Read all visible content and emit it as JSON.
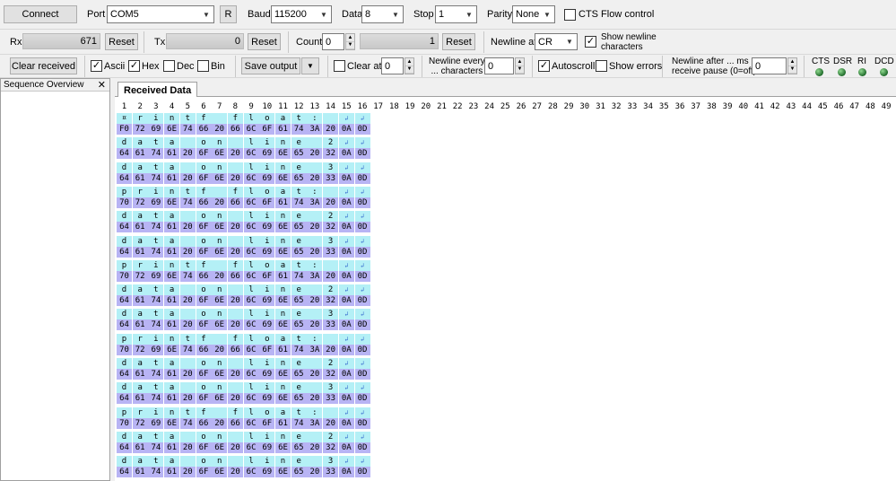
{
  "toolbar1": {
    "connect_label": "Connect",
    "port_label": "Port",
    "port_value": "COM5",
    "r_label": "R",
    "baud_label": "Baud",
    "baud_value": "115200",
    "data_label": "Data",
    "data_value": "8",
    "stop_label": "Stop",
    "stop_value": "1",
    "parity_label": "Parity",
    "parity_value": "None",
    "cts_label": "CTS Flow control"
  },
  "toolbar2": {
    "rx_label": "Rx",
    "rx_value": "671",
    "rx_reset": "Reset",
    "tx_label": "Tx",
    "tx_value": "0",
    "tx_reset": "Reset",
    "count_label": "Count",
    "count_value": "0",
    "count_field": "1",
    "count_reset": "Reset",
    "newline_at_label": "Newline at",
    "newline_at_value": "CR",
    "show_newline_label1": "Show newline",
    "show_newline_label2": "characters"
  },
  "toolbar3": {
    "clear_received": "Clear received",
    "ascii_label": "Ascii",
    "hex_label": "Hex",
    "dec_label": "Dec",
    "bin_label": "Bin",
    "save_output": "Save output",
    "clear_at_label": "Clear at",
    "clear_at_value": "0",
    "newline_every1": "Newline every",
    "newline_every2": "... characters",
    "newline_every_value": "0",
    "autoscroll_label": "Autoscroll",
    "show_errors_label": "Show errors",
    "newline_after1": "Newline after ... ms",
    "newline_after2": "receive pause (0=off)",
    "newline_after_value": "0",
    "cts": "CTS",
    "dsr": "DSR",
    "ri": "RI",
    "dcd": "DCD"
  },
  "side": {
    "title": "Sequence Overview",
    "close": "✕"
  },
  "received": {
    "tab_label": "Received Data"
  },
  "columns": [
    "1",
    "2",
    "3",
    "4",
    "5",
    "6",
    "7",
    "8",
    "9",
    "10",
    "11",
    "12",
    "13",
    "14",
    "15",
    "16",
    "17",
    "18",
    "19",
    "20",
    "21",
    "22",
    "23",
    "24",
    "25",
    "26",
    "27",
    "28",
    "29",
    "30",
    "31",
    "32",
    "33",
    "34",
    "35",
    "36",
    "37",
    "38",
    "39",
    "40",
    "41",
    "42",
    "43",
    "44",
    "45",
    "46",
    "47",
    "48",
    "49"
  ],
  "rows": [
    {
      "ascii": [
        "¤",
        "r",
        "i",
        "n",
        "t",
        "f",
        " ",
        "f",
        "l",
        "o",
        "a",
        "t",
        ":",
        " ",
        "↲",
        "↲"
      ],
      "hex": [
        "F0",
        "72",
        "69",
        "6E",
        "74",
        "66",
        "20",
        "66",
        "6C",
        "6F",
        "61",
        "74",
        "3A",
        "20",
        "0A",
        "0D"
      ]
    },
    {
      "ascii": [
        "d",
        "a",
        "t",
        "a",
        " ",
        "o",
        "n",
        " ",
        "l",
        "i",
        "n",
        "e",
        " ",
        "2",
        "↲",
        "↲"
      ],
      "hex": [
        "64",
        "61",
        "74",
        "61",
        "20",
        "6F",
        "6E",
        "20",
        "6C",
        "69",
        "6E",
        "65",
        "20",
        "32",
        "0A",
        "0D"
      ]
    },
    {
      "ascii": [
        "d",
        "a",
        "t",
        "a",
        " ",
        "o",
        "n",
        " ",
        "l",
        "i",
        "n",
        "e",
        " ",
        "3",
        "↲",
        "↲"
      ],
      "hex": [
        "64",
        "61",
        "74",
        "61",
        "20",
        "6F",
        "6E",
        "20",
        "6C",
        "69",
        "6E",
        "65",
        "20",
        "33",
        "0A",
        "0D"
      ]
    },
    {
      "ascii": [
        "p",
        "r",
        "i",
        "n",
        "t",
        "f",
        " ",
        "f",
        "l",
        "o",
        "a",
        "t",
        ":",
        " ",
        "↲",
        "↲"
      ],
      "hex": [
        "70",
        "72",
        "69",
        "6E",
        "74",
        "66",
        "20",
        "66",
        "6C",
        "6F",
        "61",
        "74",
        "3A",
        "20",
        "0A",
        "0D"
      ]
    },
    {
      "ascii": [
        "d",
        "a",
        "t",
        "a",
        " ",
        "o",
        "n",
        " ",
        "l",
        "i",
        "n",
        "e",
        " ",
        "2",
        "↲",
        "↲"
      ],
      "hex": [
        "64",
        "61",
        "74",
        "61",
        "20",
        "6F",
        "6E",
        "20",
        "6C",
        "69",
        "6E",
        "65",
        "20",
        "32",
        "0A",
        "0D"
      ]
    },
    {
      "ascii": [
        "d",
        "a",
        "t",
        "a",
        " ",
        "o",
        "n",
        " ",
        "l",
        "i",
        "n",
        "e",
        " ",
        "3",
        "↲",
        "↲"
      ],
      "hex": [
        "64",
        "61",
        "74",
        "61",
        "20",
        "6F",
        "6E",
        "20",
        "6C",
        "69",
        "6E",
        "65",
        "20",
        "33",
        "0A",
        "0D"
      ]
    },
    {
      "ascii": [
        "p",
        "r",
        "i",
        "n",
        "t",
        "f",
        " ",
        "f",
        "l",
        "o",
        "a",
        "t",
        ":",
        " ",
        "↲",
        "↲"
      ],
      "hex": [
        "70",
        "72",
        "69",
        "6E",
        "74",
        "66",
        "20",
        "66",
        "6C",
        "6F",
        "61",
        "74",
        "3A",
        "20",
        "0A",
        "0D"
      ]
    },
    {
      "ascii": [
        "d",
        "a",
        "t",
        "a",
        " ",
        "o",
        "n",
        " ",
        "l",
        "i",
        "n",
        "e",
        " ",
        "2",
        "↲",
        "↲"
      ],
      "hex": [
        "64",
        "61",
        "74",
        "61",
        "20",
        "6F",
        "6E",
        "20",
        "6C",
        "69",
        "6E",
        "65",
        "20",
        "32",
        "0A",
        "0D"
      ]
    },
    {
      "ascii": [
        "d",
        "a",
        "t",
        "a",
        " ",
        "o",
        "n",
        " ",
        "l",
        "i",
        "n",
        "e",
        " ",
        "3",
        "↲",
        "↲"
      ],
      "hex": [
        "64",
        "61",
        "74",
        "61",
        "20",
        "6F",
        "6E",
        "20",
        "6C",
        "69",
        "6E",
        "65",
        "20",
        "33",
        "0A",
        "0D"
      ]
    },
    {
      "ascii": [
        "p",
        "r",
        "i",
        "n",
        "t",
        "f",
        " ",
        "f",
        "l",
        "o",
        "a",
        "t",
        ":",
        " ",
        "↲",
        "↲"
      ],
      "hex": [
        "70",
        "72",
        "69",
        "6E",
        "74",
        "66",
        "20",
        "66",
        "6C",
        "6F",
        "61",
        "74",
        "3A",
        "20",
        "0A",
        "0D"
      ]
    },
    {
      "ascii": [
        "d",
        "a",
        "t",
        "a",
        " ",
        "o",
        "n",
        " ",
        "l",
        "i",
        "n",
        "e",
        " ",
        "2",
        "↲",
        "↲"
      ],
      "hex": [
        "64",
        "61",
        "74",
        "61",
        "20",
        "6F",
        "6E",
        "20",
        "6C",
        "69",
        "6E",
        "65",
        "20",
        "32",
        "0A",
        "0D"
      ]
    },
    {
      "ascii": [
        "d",
        "a",
        "t",
        "a",
        " ",
        "o",
        "n",
        " ",
        "l",
        "i",
        "n",
        "e",
        " ",
        "3",
        "↲",
        "↲"
      ],
      "hex": [
        "64",
        "61",
        "74",
        "61",
        "20",
        "6F",
        "6E",
        "20",
        "6C",
        "69",
        "6E",
        "65",
        "20",
        "33",
        "0A",
        "0D"
      ]
    },
    {
      "ascii": [
        "p",
        "r",
        "i",
        "n",
        "t",
        "f",
        " ",
        "f",
        "l",
        "o",
        "a",
        "t",
        ":",
        " ",
        "↲",
        "↲"
      ],
      "hex": [
        "70",
        "72",
        "69",
        "6E",
        "74",
        "66",
        "20",
        "66",
        "6C",
        "6F",
        "61",
        "74",
        "3A",
        "20",
        "0A",
        "0D"
      ]
    },
    {
      "ascii": [
        "d",
        "a",
        "t",
        "a",
        " ",
        "o",
        "n",
        " ",
        "l",
        "i",
        "n",
        "e",
        " ",
        "2",
        "↲",
        "↲"
      ],
      "hex": [
        "64",
        "61",
        "74",
        "61",
        "20",
        "6F",
        "6E",
        "20",
        "6C",
        "69",
        "6E",
        "65",
        "20",
        "32",
        "0A",
        "0D"
      ]
    },
    {
      "ascii": [
        "d",
        "a",
        "t",
        "a",
        " ",
        "o",
        "n",
        " ",
        "l",
        "i",
        "n",
        "e",
        " ",
        "3",
        "↲",
        "↲"
      ],
      "hex": [
        "64",
        "61",
        "74",
        "61",
        "20",
        "6F",
        "6E",
        "20",
        "6C",
        "69",
        "6E",
        "65",
        "20",
        "33",
        "0A",
        "0D"
      ]
    }
  ],
  "colors": {
    "ascii_bg": "#b4f0f6",
    "hex_bg": "#b8b4f4",
    "led_green": "#1f6b2a"
  }
}
